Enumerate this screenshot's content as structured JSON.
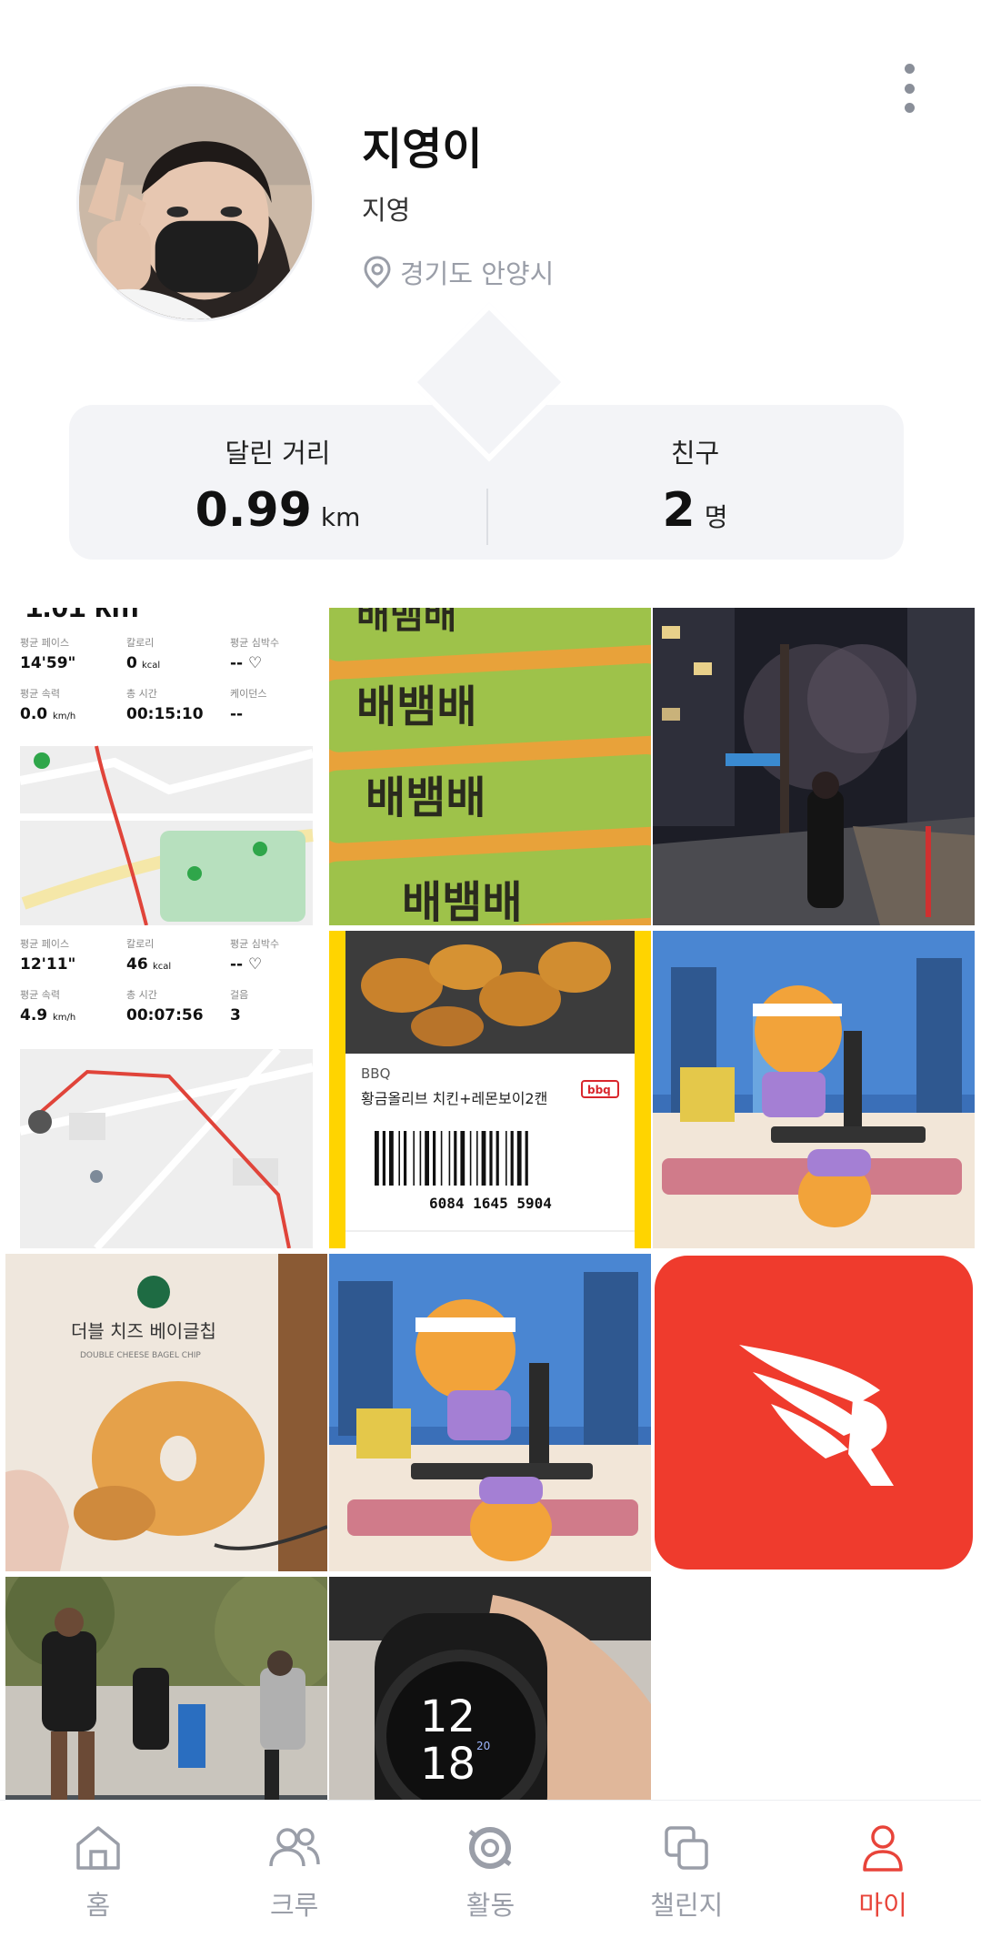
{
  "profile": {
    "nickname": "지영이",
    "name": "지영",
    "location": "경기도 안양시"
  },
  "stats": {
    "distance_label": "달린 거리",
    "distance_value": "0.99",
    "distance_unit": "km",
    "friends_label": "친구",
    "friends_value": "2",
    "friends_unit": "명"
  },
  "posts": [
    {
      "name": "run-record-1",
      "cells": [
        {
          "label": "평균 페이스",
          "value": "14'59\""
        },
        {
          "label": "칼로리",
          "value": "0",
          "unit": "kcal"
        },
        {
          "label": "평균 심박수",
          "value": "-- ♡"
        },
        {
          "label": "평균 속력",
          "value": "0.0",
          "unit": "km/h"
        },
        {
          "label": "총 시간",
          "value": "00:15:10"
        },
        {
          "label": "케이던스",
          "value": "--"
        }
      ]
    },
    {
      "name": "snack-bar-photo",
      "text": "배뱀배"
    },
    {
      "name": "night-street-photo"
    },
    {
      "name": "run-record-2",
      "cells": [
        {
          "label": "평균 페이스",
          "value": "12'11\""
        },
        {
          "label": "칼로리",
          "value": "46",
          "unit": "kcal"
        },
        {
          "label": "평균 심박수",
          "value": "-- ♡"
        },
        {
          "label": "평균 속력",
          "value": "4.9",
          "unit": "km/h"
        },
        {
          "label": "총 시간",
          "value": "00:07:56"
        },
        {
          "label": "걸음",
          "value": "3"
        }
      ]
    },
    {
      "name": "bbq-coupon",
      "brand": "BBQ",
      "product": "황금올리브 치킨+레몬보이2캔",
      "barcode": "6084 1645 5904",
      "logo": "bbq"
    },
    {
      "name": "treadmill-character-1"
    },
    {
      "name": "cookie-bag-photo",
      "title": "더블 치즈 베이글칩",
      "subtitle": "DOUBLE CHEESE BAGEL CHIP"
    },
    {
      "name": "treadmill-character-2"
    },
    {
      "name": "app-logo-tile"
    },
    {
      "name": "group-run-photo"
    },
    {
      "name": "smartwatch-photo",
      "time_h": "12",
      "time_m": "18",
      "date": "20"
    }
  ],
  "nav": [
    {
      "label": "홈",
      "icon": "home-icon"
    },
    {
      "label": "크루",
      "icon": "crew-icon"
    },
    {
      "label": "활동",
      "icon": "activity-icon"
    },
    {
      "label": "챌린지",
      "icon": "challenge-icon"
    },
    {
      "label": "마이",
      "icon": "profile-icon",
      "active": true
    }
  ],
  "colors": {
    "accent": "#e8443a",
    "card_bg": "#f3f4f7",
    "muted": "#9a9ea8"
  }
}
